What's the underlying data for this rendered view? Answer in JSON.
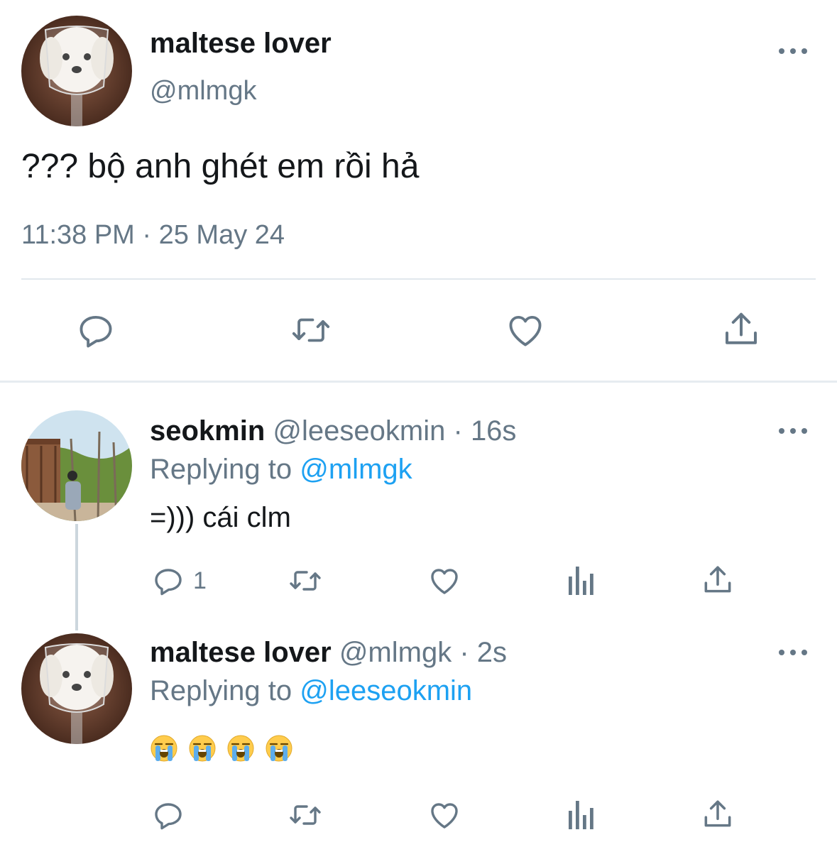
{
  "main_tweet": {
    "display_name": "maltese lover",
    "handle": "@mlmgk",
    "text": "??? bộ anh ghét em rồi hả",
    "timestamp": "11:38 PM · 25 May 24",
    "avatar_icon": "maltese-dog-in-wine-glass-avatar",
    "actions": [
      "reply-icon",
      "retweet-icon",
      "like-icon",
      "share-icon"
    ]
  },
  "replies": [
    {
      "display_name": "seokmin",
      "handle": "@leeseokmin",
      "time": "16s",
      "replying_prefix": "Replying to",
      "replying_to": "@mlmgk",
      "text": "=))) cái clm",
      "reply_count": "1",
      "avatar_icon": "outdoor-photo-avatar"
    },
    {
      "display_name": "maltese lover",
      "handle": "@mlmgk",
      "time": "2s",
      "replying_prefix": "Replying to",
      "replying_to": "@leeseokmin",
      "text": "😭😭😭😭",
      "reply_count": "",
      "avatar_icon": "maltese-dog-in-wine-glass-avatar"
    }
  ],
  "separator": "·",
  "colors": {
    "text": "#14171a",
    "muted": "#657786",
    "link": "#1da1f2",
    "divider": "#e1e8ed"
  }
}
